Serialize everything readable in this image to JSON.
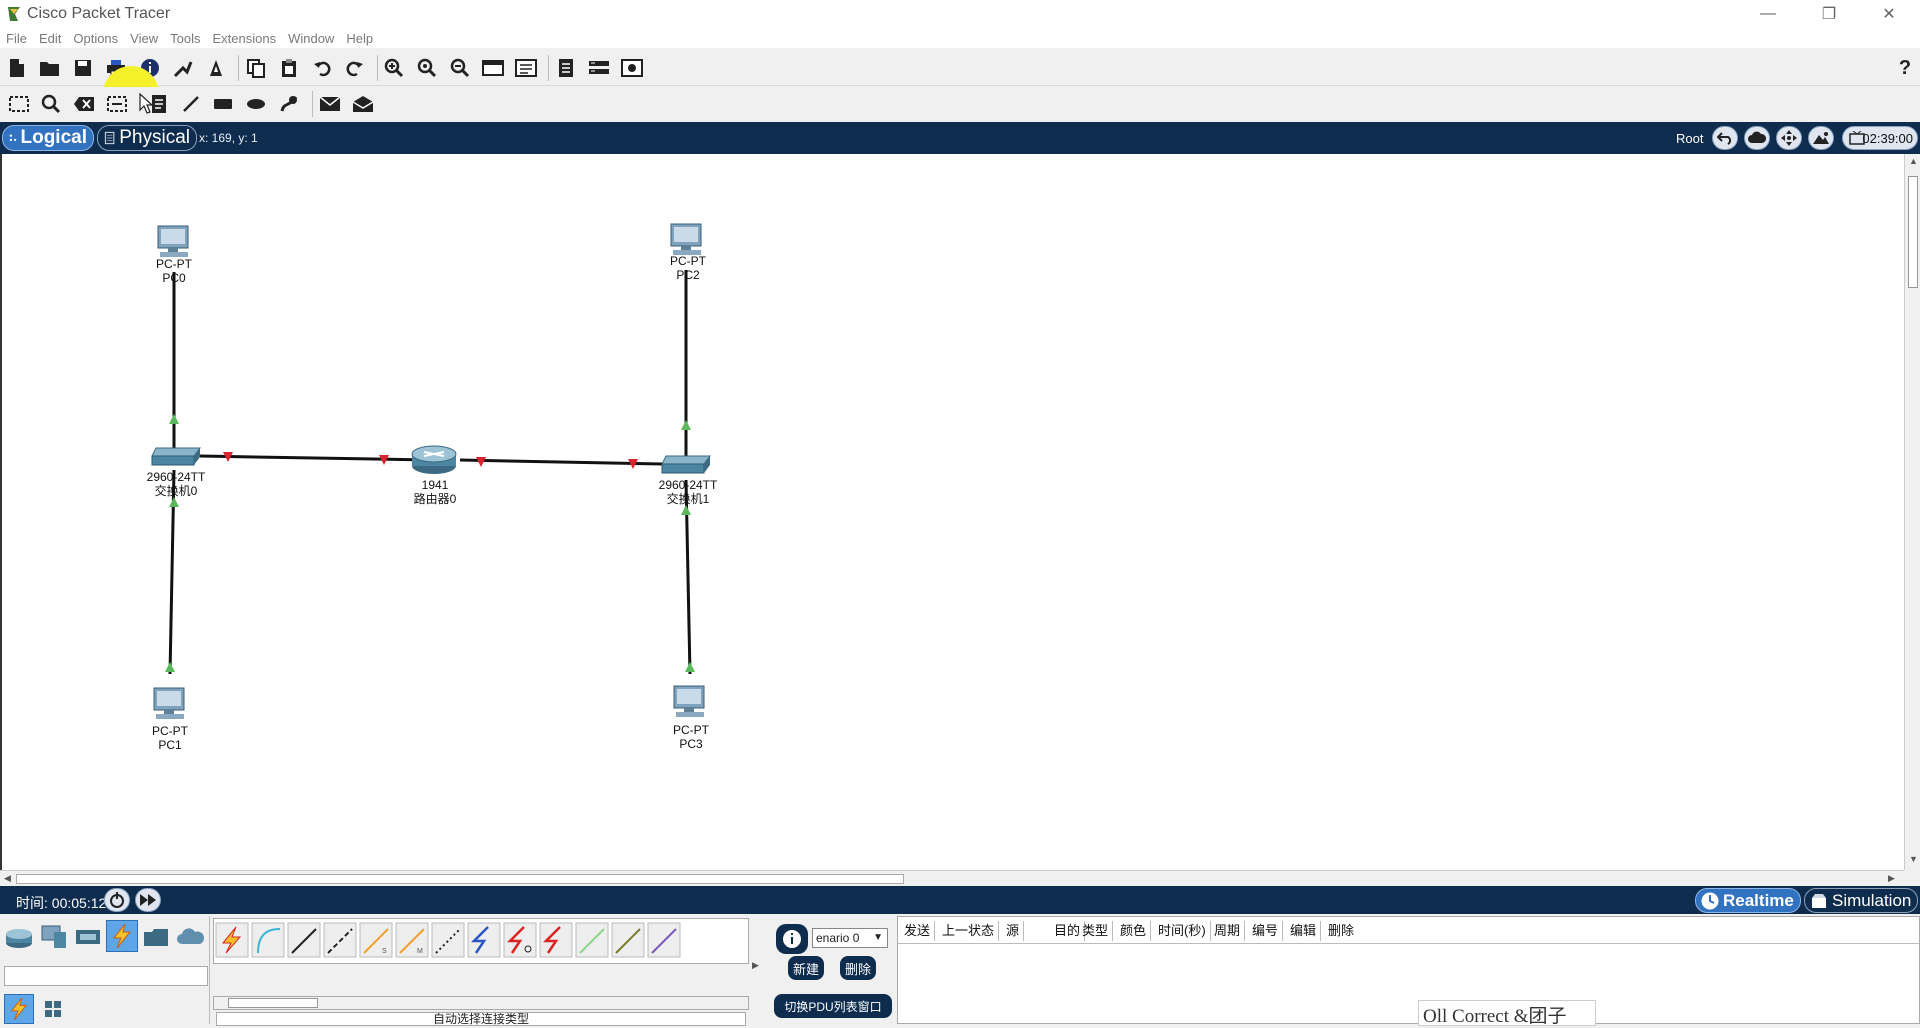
{
  "app": {
    "title": "Cisco Packet Tracer"
  },
  "window_controls": {
    "minimize": "—",
    "restore": "❐",
    "close": "✕"
  },
  "menu": [
    "File",
    "Edit",
    "Options",
    "View",
    "Tools",
    "Extensions",
    "Window",
    "Help"
  ],
  "toolbar": {
    "help_label": "?"
  },
  "workspace": {
    "logical_tab": "Logical",
    "physical_tab": "Physical",
    "coords": "x: 169, y: 1",
    "root_label": "Root",
    "clock": "02:39:00"
  },
  "topology": {
    "devices": [
      {
        "id": "pc0",
        "model": "PC-PT",
        "name": "PC0"
      },
      {
        "id": "pc2",
        "model": "PC-PT",
        "name": "PC2"
      },
      {
        "id": "switch0",
        "model": "2960-24TT",
        "name": "交换机0"
      },
      {
        "id": "router0",
        "model": "1941",
        "name": "路由器0"
      },
      {
        "id": "switch1",
        "model": "2960-24TT",
        "name": "交换机1"
      },
      {
        "id": "pc1",
        "model": "PC-PT",
        "name": "PC1"
      },
      {
        "id": "pc3",
        "model": "PC-PT",
        "name": "PC3"
      }
    ]
  },
  "bottom": {
    "time_label": "时间: 00:05:12",
    "realtime": "Realtime",
    "simulation": "Simulation",
    "scenario": "enario 0",
    "new_button": "新建",
    "delete_button": "删除",
    "toggle_pdu": "切换PDU列表窗口",
    "cable_caption": "自动选择连接类型",
    "pdu_columns": [
      "发送",
      "上一状态",
      "源",
      "目的",
      "类型",
      "颜色",
      "时间(秒)",
      "周期",
      "编号",
      "编辑",
      "删除"
    ],
    "watermark": "Oll Correct &团子"
  },
  "colors": {
    "accent": "#3172c1",
    "dark_bar": "#0e2c4e",
    "link_up": "#5cb85c",
    "link_down": "#d9232e"
  }
}
